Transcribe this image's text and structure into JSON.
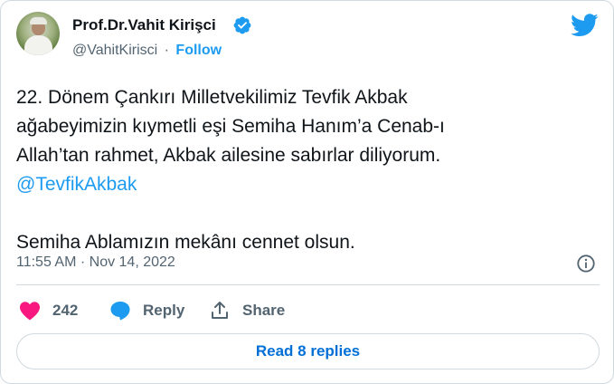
{
  "author": {
    "name": "Prof.Dr.Vahit Kirişci",
    "handle": "@VahitKirisci",
    "separator": "·",
    "follow_label": "Follow"
  },
  "tweet": {
    "line1": "22. Dönem Çankırı Milletvekilimiz Tevfik Akbak",
    "line2": "ağabeyimizin kıymetli eşi Semiha Hanım’a Cenab-ı",
    "line3": "Allah’tan rahmet, Akbak ailesine sabırlar diliyorum.",
    "mention": "@TevfikAkbak",
    "line5": "Semiha Ablamızın mekânı cennet olsun."
  },
  "meta": {
    "timestamp": "11:55 AM · Nov 14, 2022"
  },
  "actions": {
    "like_count": "242",
    "reply_label": "Reply",
    "share_label": "Share"
  },
  "read_replies_label": "Read 8 replies",
  "colors": {
    "accent": "#1d9bf0",
    "like": "#f91880",
    "text": "#0f1419",
    "muted": "#536471",
    "border": "#cfd9de"
  },
  "icons": {
    "verified": "verified-badge-icon",
    "brand": "twitter-bird-icon",
    "info": "info-icon",
    "like": "heart-icon",
    "reply": "speech-bubble-icon",
    "share": "share-upload-icon"
  }
}
